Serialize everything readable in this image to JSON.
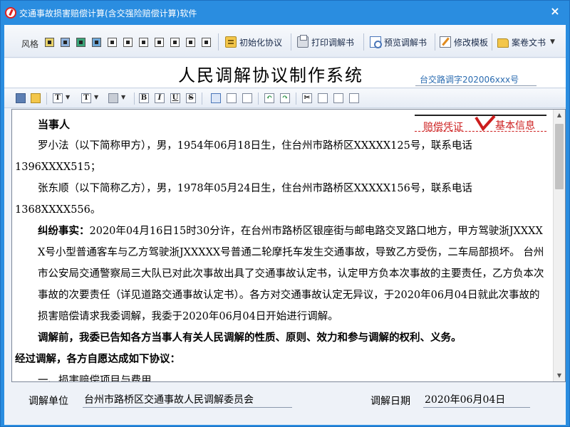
{
  "window": {
    "title": "交通事故损害赔偿计算(含交强险赔偿计算)软件",
    "close_glyph": "×"
  },
  "toolbar": {
    "style_label": "风格",
    "swatch_count": 10,
    "buttons": [
      {
        "name": "init-agreement",
        "label": "初始化协议",
        "icon": "init-icon"
      },
      {
        "name": "print-mediation",
        "label": "打印调解书",
        "icon": "printer-icon"
      },
      {
        "name": "preview-mediation",
        "label": "预览调解书",
        "icon": "preview-icon"
      },
      {
        "name": "edit-template",
        "label": "修改模板",
        "icon": "edit-icon"
      },
      {
        "name": "case-files",
        "label": "案卷文书",
        "icon": "folder-icon"
      }
    ],
    "dropdown_glyph": "▼"
  },
  "header": {
    "title": "人民调解协议制作系统",
    "doc_number": "台交路调字202006xxx号"
  },
  "format_toolbar": {
    "bold": "B",
    "italic": "I",
    "underline": "U",
    "strike": "S",
    "font": "T",
    "font_size": "T",
    "arrow": "▼"
  },
  "nav": {
    "left_link": "赔偿凭证",
    "right_link": "基本信息"
  },
  "document": {
    "parties_heading": "当事人",
    "party_a_line1": "罗小法（以下简称甲方），男，1954年06月18日生，住台州市路桥区XXXXX125号，联系电话",
    "party_a_line2": "1396XXXX515；",
    "party_b_line1": "张东顺（以下简称乙方），男，1978年05月24日生，住台州市路桥区XXXXX156号，联系电话",
    "party_b_line2": "1368XXXX556。",
    "facts_label": "纠纷事实：",
    "facts_text": "2020年04月16日15时30分许，在台州市路桥区银座街与邮电路交叉路口地方，甲方驾驶浙JXXXXX号小型普通客车与乙方驾驶浙JXXXXX号普通二轮摩托车发生交通事故，导致乙方受伤，二车局部损坏。 台州市公安局交通警察局三大队已对此次事故出具了交通事故认定书，认定甲方负本次事故的主要责任，乙方负本次事故的次要责任（详见道路交通事故认定书）。各方对交通事故认定无异议，于2020年06月04日就此次事故的损害赔偿请求我委调解，我委于2020年06月04日开始进行调解。",
    "pre_mediation": "调解前，我委已告知各方当事人有关人民调解的性质、原则、效力和参与调解的权利、义务。",
    "agreement_intro": "经过调解，各方自愿达成如下协议：",
    "item_one": "一、损害赔偿项目与费用"
  },
  "footer": {
    "unit_label": "调解单位",
    "unit_value": "台州市路桥区交通事故人民调解委员会",
    "date_label": "调解日期",
    "date_value": "2020年06月04日"
  },
  "colors": {
    "titlebar": "#2a8de0",
    "accent_red": "#cc1d1d",
    "doc_number": "#2a6bb0"
  }
}
